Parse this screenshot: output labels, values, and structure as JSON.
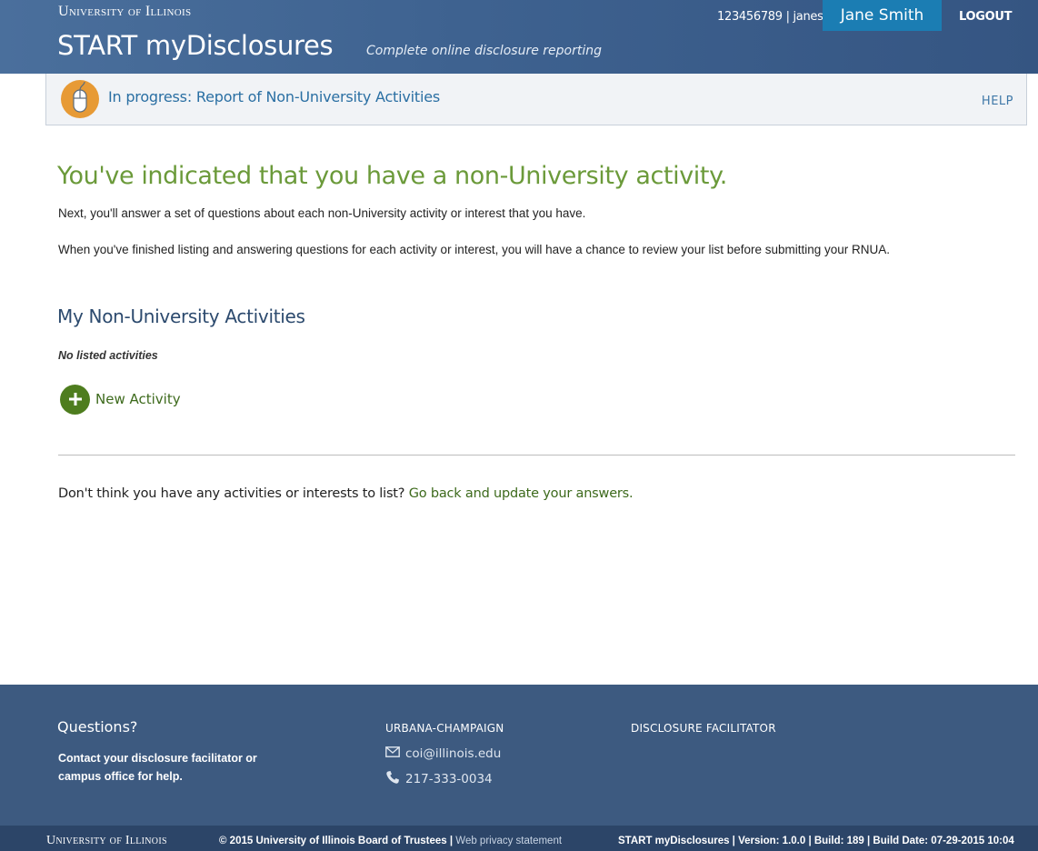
{
  "header": {
    "university_wordmark": "University of Illinois",
    "app_title": "START myDisclosures",
    "tagline": "Complete online disclosure reporting",
    "user_ids": "123456789  |  janes",
    "user_name": "Jane Smith",
    "logout_label": "LOGOUT"
  },
  "progress": {
    "status_text": "In progress: Report of Non-University Activities",
    "help_label": "HELP",
    "icon": "computer-mouse-icon",
    "icon_color": "#e79a35"
  },
  "main": {
    "heading": "You've indicated that you have a non-University activity.",
    "intro_1": "Next, you'll answer a set of questions about each non-University activity or interest that you have.",
    "intro_2": "When you've finished listing and answering questions for each activity or interest, you will have a chance to review your list before submitting your RNUA.",
    "section_heading": "My Non-University Activities",
    "empty_note": "No listed activities",
    "new_activity_label": "New Activity",
    "back_prompt": "Don't think you have any activities or interests to list?",
    "back_link": "Go back and update your answers."
  },
  "footer": {
    "questions_title": "Questions?",
    "contact_text": "Contact your disclosure facilitator or campus office for help.",
    "campus_label": "URBANA-CHAMPAIGN",
    "email": "coi@illinois.edu",
    "phone": "217-333-0034",
    "facilitator_label": "DISCLOSURE FACILITATOR"
  },
  "bottom_bar": {
    "wordmark": "University of Illinois",
    "copyright": "© 2015 University of Illinois Board of Trustees | ",
    "privacy_link": "Web privacy statement",
    "version_info": "START myDisclosures | Version: 1.0.0 | Build: 189 | Build Date: 07-29-2015 10:04"
  },
  "colors": {
    "header_bg": "#3e6290",
    "accent_blue": "#1b7db3",
    "heading_green": "#6b9a3a",
    "link_green": "#3d6a1c",
    "footer_bg": "#3d5a80",
    "bottom_bar_bg": "#2c4568"
  }
}
